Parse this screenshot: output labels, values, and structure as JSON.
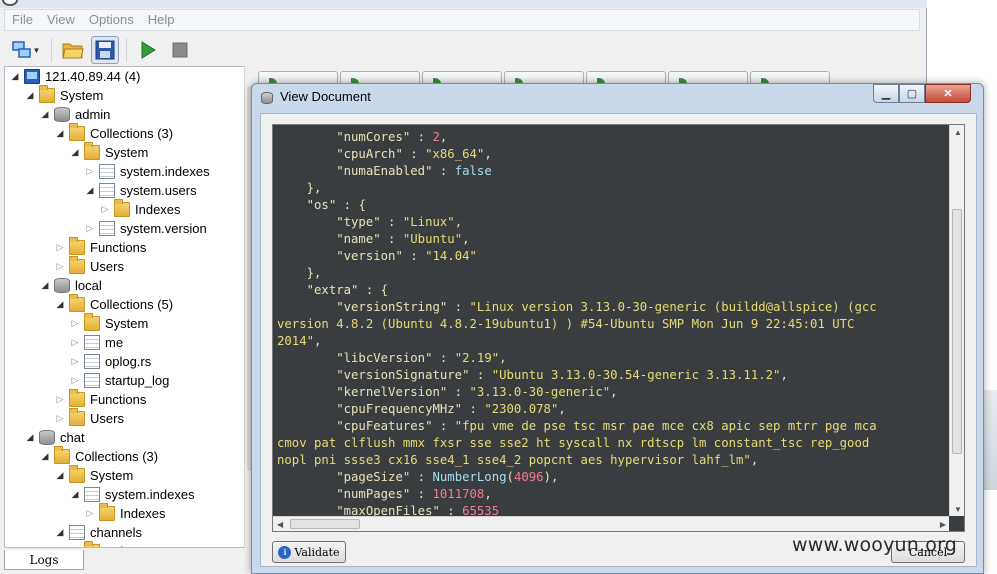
{
  "menu": [
    "File",
    "View",
    "Options",
    "Help"
  ],
  "toolbar": [
    {
      "icon": "connect-icon",
      "has_dropdown": true
    },
    {
      "icon": "open-folder-icon"
    },
    {
      "icon": "save-icon",
      "active": true
    },
    {
      "icon": "run-icon",
      "color": "#2f9e3a"
    },
    {
      "icon": "stop-icon",
      "color": "#8a8a8a"
    }
  ],
  "tree": [
    {
      "label": "121.40.89.44 (4)",
      "icon": "server",
      "depth": 0,
      "exp": "open"
    },
    {
      "label": "System",
      "icon": "folder",
      "depth": 1,
      "exp": "open"
    },
    {
      "label": "admin",
      "icon": "db",
      "depth": 2,
      "exp": "open"
    },
    {
      "label": "Collections (3)",
      "icon": "folder",
      "depth": 3,
      "exp": "open"
    },
    {
      "label": "System",
      "icon": "folder",
      "depth": 4,
      "exp": "open"
    },
    {
      "label": "system.indexes",
      "icon": "coll",
      "depth": 5,
      "exp": "closed"
    },
    {
      "label": "system.users",
      "icon": "coll",
      "depth": 5,
      "exp": "open"
    },
    {
      "label": "Indexes",
      "icon": "folder",
      "depth": 6,
      "exp": "closed"
    },
    {
      "label": "system.version",
      "icon": "coll",
      "depth": 5,
      "exp": "closed"
    },
    {
      "label": "Functions",
      "icon": "folder",
      "depth": 3,
      "exp": "closed"
    },
    {
      "label": "Users",
      "icon": "folder",
      "depth": 3,
      "exp": "closed"
    },
    {
      "label": "local",
      "icon": "db",
      "depth": 2,
      "exp": "open"
    },
    {
      "label": "Collections (5)",
      "icon": "folder",
      "depth": 3,
      "exp": "open"
    },
    {
      "label": "System",
      "icon": "folder",
      "depth": 4,
      "exp": "closed"
    },
    {
      "label": "me",
      "icon": "coll",
      "depth": 4,
      "exp": "closed"
    },
    {
      "label": "oplog.rs",
      "icon": "coll",
      "depth": 4,
      "exp": "closed"
    },
    {
      "label": "startup_log",
      "icon": "coll",
      "depth": 4,
      "exp": "closed"
    },
    {
      "label": "Functions",
      "icon": "folder",
      "depth": 3,
      "exp": "closed"
    },
    {
      "label": "Users",
      "icon": "folder",
      "depth": 3,
      "exp": "closed"
    },
    {
      "label": "chat",
      "icon": "db",
      "depth": 1,
      "exp": "open"
    },
    {
      "label": "Collections (3)",
      "icon": "folder",
      "depth": 2,
      "exp": "open"
    },
    {
      "label": "System",
      "icon": "folder",
      "depth": 3,
      "exp": "open"
    },
    {
      "label": "system.indexes",
      "icon": "coll",
      "depth": 4,
      "exp": "open"
    },
    {
      "label": "Indexes",
      "icon": "folder",
      "depth": 5,
      "exp": "closed"
    },
    {
      "label": "channels",
      "icon": "coll",
      "depth": 3,
      "exp": "open"
    },
    {
      "label": "Indexes",
      "icon": "folder",
      "depth": 4,
      "exp": "closed"
    }
  ],
  "logs_tab": "Logs",
  "dialog": {
    "title": "View Document",
    "validate_label": "Validate",
    "cancel_label": "Cancel"
  },
  "code_lines": [
    [
      [
        "k",
        "        \"numCores\""
      ],
      [
        "p",
        " : "
      ],
      [
        "n",
        "2"
      ],
      [
        "p",
        ","
      ]
    ],
    [
      [
        "k",
        "        \"cpuArch\""
      ],
      [
        "p",
        " : "
      ],
      [
        "s",
        "\"x86_64\""
      ],
      [
        "p",
        ","
      ]
    ],
    [
      [
        "k",
        "        \"numaEnabled\""
      ],
      [
        "p",
        " : "
      ],
      [
        "b",
        "false"
      ]
    ],
    [
      [
        "p",
        "    },"
      ]
    ],
    [
      [
        "k",
        "    \"os\""
      ],
      [
        "p",
        " : {"
      ]
    ],
    [
      [
        "k",
        "        \"type\""
      ],
      [
        "p",
        " : "
      ],
      [
        "s",
        "\"Linux\""
      ],
      [
        "p",
        ","
      ]
    ],
    [
      [
        "k",
        "        \"name\""
      ],
      [
        "p",
        " : "
      ],
      [
        "s",
        "\"Ubuntu\""
      ],
      [
        "p",
        ","
      ]
    ],
    [
      [
        "k",
        "        \"version\""
      ],
      [
        "p",
        " : "
      ],
      [
        "s",
        "\"14.04\""
      ]
    ],
    [
      [
        "p",
        "    },"
      ]
    ],
    [
      [
        "k",
        "    \"extra\""
      ],
      [
        "p",
        " : {"
      ]
    ],
    [
      [
        "k",
        "        \"versionString\""
      ],
      [
        "p",
        " : "
      ],
      [
        "s",
        "\"Linux version 3.13.0-30-generic (buildd@allspice) (gcc"
      ]
    ],
    [
      [
        "s",
        "version 4.8.2 (Ubuntu 4.8.2-19ubuntu1) ) #54-Ubuntu SMP Mon Jun 9 22:45:01 UTC"
      ]
    ],
    [
      [
        "s",
        "2014\""
      ],
      [
        "p",
        ","
      ]
    ],
    [
      [
        "k",
        "        \"libcVersion\""
      ],
      [
        "p",
        " : "
      ],
      [
        "s",
        "\"2.19\""
      ],
      [
        "p",
        ","
      ]
    ],
    [
      [
        "k",
        "        \"versionSignature\""
      ],
      [
        "p",
        " : "
      ],
      [
        "s",
        "\"Ubuntu 3.13.0-30.54-generic 3.13.11.2\""
      ],
      [
        "p",
        ","
      ]
    ],
    [
      [
        "k",
        "        \"kernelVersion\""
      ],
      [
        "p",
        " : "
      ],
      [
        "s",
        "\"3.13.0-30-generic\""
      ],
      [
        "p",
        ","
      ]
    ],
    [
      [
        "k",
        "        \"cpuFrequencyMHz\""
      ],
      [
        "p",
        " : "
      ],
      [
        "s",
        "\"2300.078\""
      ],
      [
        "p",
        ","
      ]
    ],
    [
      [
        "k",
        "        \"cpuFeatures\""
      ],
      [
        "p",
        " : "
      ],
      [
        "s",
        "\"fpu vme de pse tsc msr pae mce cx8 apic sep mtrr pge mca"
      ]
    ],
    [
      [
        "s",
        "cmov pat clflush mmx fxsr sse sse2 ht syscall nx rdtscp lm constant_tsc rep_good"
      ]
    ],
    [
      [
        "s",
        "nopl pni ssse3 cx16 sse4_1 sse4_2 popcnt aes hypervisor lahf_lm\""
      ],
      [
        "p",
        ","
      ]
    ],
    [
      [
        "k",
        "        \"pageSize\""
      ],
      [
        "p",
        " : "
      ],
      [
        "b",
        "NumberLong"
      ],
      [
        "p",
        "("
      ],
      [
        "n",
        "4096"
      ],
      [
        "p",
        "),"
      ]
    ],
    [
      [
        "k",
        "        \"numPages\""
      ],
      [
        "p",
        " : "
      ],
      [
        "n",
        "1011708"
      ],
      [
        "p",
        ","
      ]
    ],
    [
      [
        "k",
        "        \"maxOpenFiles\""
      ],
      [
        "p",
        " : "
      ],
      [
        "n",
        "65535"
      ]
    ]
  ],
  "watermark": "www.wooyun.org",
  "colors": {
    "code_bg": "#3a3d3f",
    "code_text": "#e8e2b7",
    "code_string": "#e6db74",
    "code_number": "#f47b8f",
    "code_keyword": "#a6dcef",
    "dialog_frame": "#cad9ea",
    "close_button": "#c74a37"
  }
}
